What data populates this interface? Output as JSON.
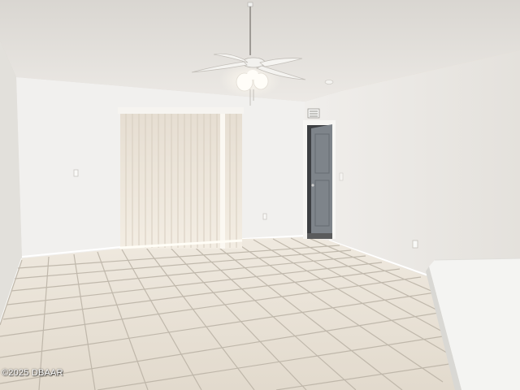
{
  "watermark": {
    "text": "©2025 DBAAR"
  },
  "colors": {
    "ceiling": "#e6e3df",
    "wall_back": "#f1f0ee",
    "wall_right": "#ebe9e5",
    "wall_left": "#e3e1dc",
    "floor_tile": "#e8e2d8",
    "grout": "#b8b0a3",
    "blinds": "#ece6dc",
    "door": "#7f858a",
    "counter": "#f4f4f2"
  },
  "icons": {
    "fan": "ceiling-fan-icon",
    "vent": "air-vent-icon"
  }
}
